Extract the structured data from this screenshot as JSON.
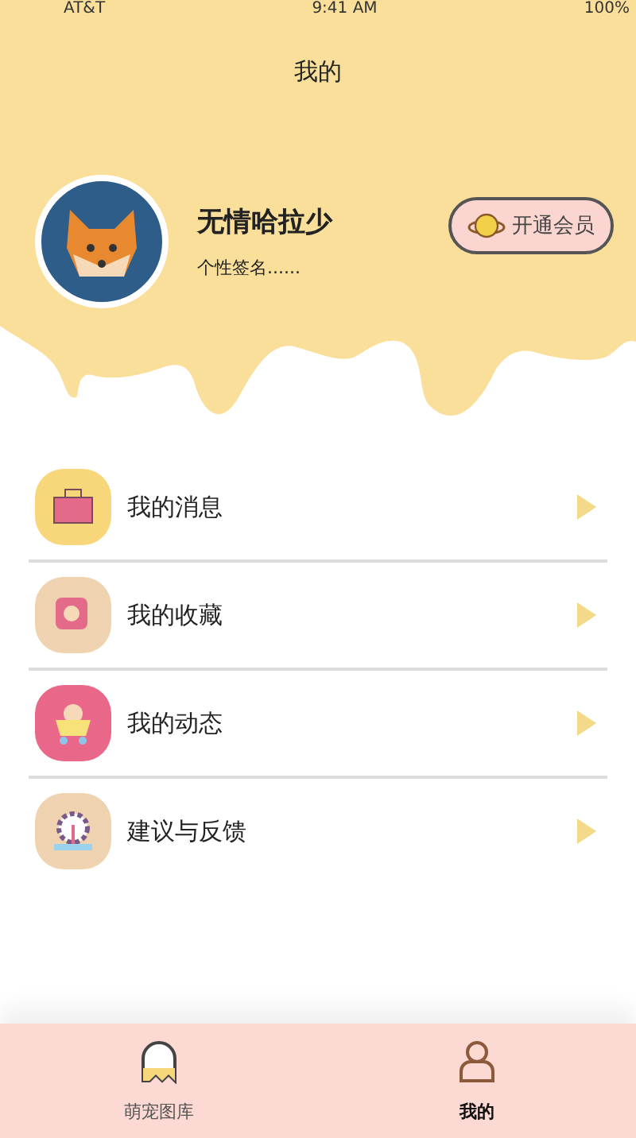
{
  "status_bar": {
    "carrier": "AT&T",
    "time": "9:41 AM",
    "battery": "100%"
  },
  "title": "我的",
  "profile": {
    "name": "无情哈拉少",
    "signature": "个性签名......",
    "vip_button": "开通会员"
  },
  "menu": [
    {
      "label": "我的消息",
      "kind": "toolbox",
      "color": "#f7d77a"
    },
    {
      "label": "我的收藏",
      "kind": "tape",
      "color": "#efd3b0"
    },
    {
      "label": "我的动态",
      "kind": "cart",
      "color": "#e9688a"
    },
    {
      "label": "建议与反馈",
      "kind": "gear",
      "color": "#efd3b0"
    }
  ],
  "tabs": [
    {
      "label": "萌宠图库",
      "kind": "ghost",
      "selected": false
    },
    {
      "label": "我的",
      "kind": "person",
      "selected": true
    }
  ]
}
